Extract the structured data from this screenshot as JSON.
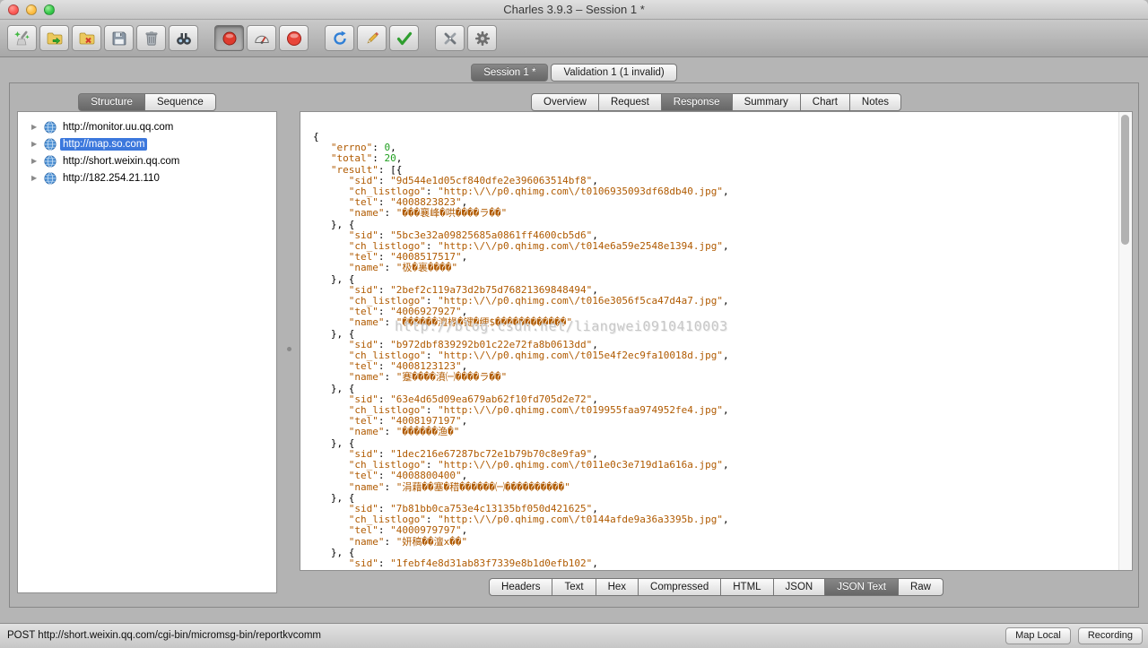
{
  "window": {
    "title": "Charles 3.9.3 – Session 1 *",
    "traffic_lights": [
      "close",
      "minimize",
      "zoom"
    ]
  },
  "toolbar": {
    "buttons": [
      {
        "name": "clear-session",
        "icon": "broom-icon"
      },
      {
        "name": "open-session",
        "icon": "folder-open-icon"
      },
      {
        "name": "export-session",
        "icon": "folder-export-icon"
      },
      {
        "name": "save-session",
        "icon": "floppy-icon"
      },
      {
        "name": "delete",
        "icon": "trash-icon"
      },
      {
        "name": "find",
        "icon": "binoculars-icon"
      },
      {
        "name": "record",
        "icon": "record-icon",
        "active": true
      },
      {
        "name": "throttle",
        "icon": "gauge-icon"
      },
      {
        "name": "breakpoints",
        "icon": "breakpoint-icon"
      },
      {
        "name": "repeat",
        "icon": "repeat-icon"
      },
      {
        "name": "edit",
        "icon": "pencil-icon"
      },
      {
        "name": "validate",
        "icon": "check-icon"
      },
      {
        "name": "tools",
        "icon": "wrench-icon"
      },
      {
        "name": "settings",
        "icon": "gear-icon"
      }
    ]
  },
  "session_tabs": [
    {
      "label": "Session 1 *",
      "active": true
    },
    {
      "label": "Validation 1 (1 invalid)",
      "active": false
    }
  ],
  "sidebar": {
    "tabs": [
      {
        "label": "Structure",
        "active": true
      },
      {
        "label": "Sequence",
        "active": false
      }
    ],
    "items": [
      {
        "label": "http://monitor.uu.qq.com",
        "selected": false
      },
      {
        "label": "http://map.so.com",
        "selected": true
      },
      {
        "label": "http://short.weixin.qq.com",
        "selected": false
      },
      {
        "label": "http://182.254.21.110",
        "selected": false
      }
    ]
  },
  "detail": {
    "tabs": [
      {
        "label": "Overview",
        "active": false
      },
      {
        "label": "Request",
        "active": false
      },
      {
        "label": "Response",
        "active": true
      },
      {
        "label": "Summary",
        "active": false
      },
      {
        "label": "Chart",
        "active": false
      },
      {
        "label": "Notes",
        "active": false
      }
    ],
    "bottom_tabs": [
      {
        "label": "Headers",
        "active": false
      },
      {
        "label": "Text",
        "active": false
      },
      {
        "label": "Hex",
        "active": false
      },
      {
        "label": "Compressed",
        "active": false
      },
      {
        "label": "HTML",
        "active": false
      },
      {
        "label": "JSON",
        "active": false
      },
      {
        "label": "JSON Text",
        "active": true
      },
      {
        "label": "Raw",
        "active": false
      }
    ],
    "watermark": "http://blog.csdn.net/liangwei0910410003"
  },
  "response_json": {
    "errno": 0,
    "total": 20,
    "result": [
      {
        "sid": "9d544e1d05cf840dfe2e396063514bf8",
        "ch_listlogo": "http:\\/\\/p0.qhimg.com\\/t0106935093df68db40.jpg",
        "tel": "4008823823",
        "name": "���襄峰�哄����ラ��"
      },
      {
        "sid": "5bc3e32a09825685a0861ff4600cb5d6",
        "ch_listlogo": "http:\\/\\/p0.qhimg.com\\/t014e6a59e2548e1394.jpg",
        "tel": "4008517517",
        "name": "极�裏����"
      },
      {
        "sid": "2bef2c119a73d2b75d76821369848494",
        "ch_listlogo": "http:\\/\\/p0.qhimg.com\\/t016e3056f5ca47d4a7.jpg",
        "tel": "4006927927",
        "name": "������澶椽�键�绠$������������"
      },
      {
        "sid": "b972dbf839292b01c22e72fa8b0613dd",
        "ch_listlogo": "http:\\/\\/p0.qhimg.com\\/t015e4f2ec9fa10018d.jpg",
        "tel": "4008123123",
        "name": "蹇����濆㈠����ラ��"
      },
      {
        "sid": "63e4d65d09ea679ab62f10fd705d2e72",
        "ch_listlogo": "http:\\/\\/p0.qhimg.com\\/t019955faa974952fe4.jpg",
        "tel": "4008197197",
        "name": "������渔�"
      },
      {
        "sid": "1dec216e67287bc72e1b79b70c8e9fa9",
        "ch_listlogo": "http:\\/\\/p0.qhimg.com\\/t011e0c3e719d1a616a.jpg",
        "tel": "4008800400",
        "name": "涓藉��塞�稓������㈠����������"
      },
      {
        "sid": "7b81bb0ca753e4c13135bf050d421625",
        "ch_listlogo": "http:\\/\\/p0.qhimg.com\\/t0144afde9a36a3395b.jpg",
        "tel": "4000979797",
        "name": "妍稿��澶х��"
      }
    ],
    "partial_next_sid": "1febf4e8d31ab83f7339e8b1d0efb102"
  },
  "status_bar": {
    "text": "POST http://short.weixin.qq.com/cgi-bin/micromsg-bin/reportkvcomm",
    "buttons": [
      {
        "label": "Map Local"
      },
      {
        "label": "Recording"
      }
    ]
  },
  "palette": {
    "selection_blue": "#3c78dd",
    "json_string_orange": "#b05a00",
    "json_number_green": "#1f9e1f",
    "record_red": "#df3b2e"
  }
}
